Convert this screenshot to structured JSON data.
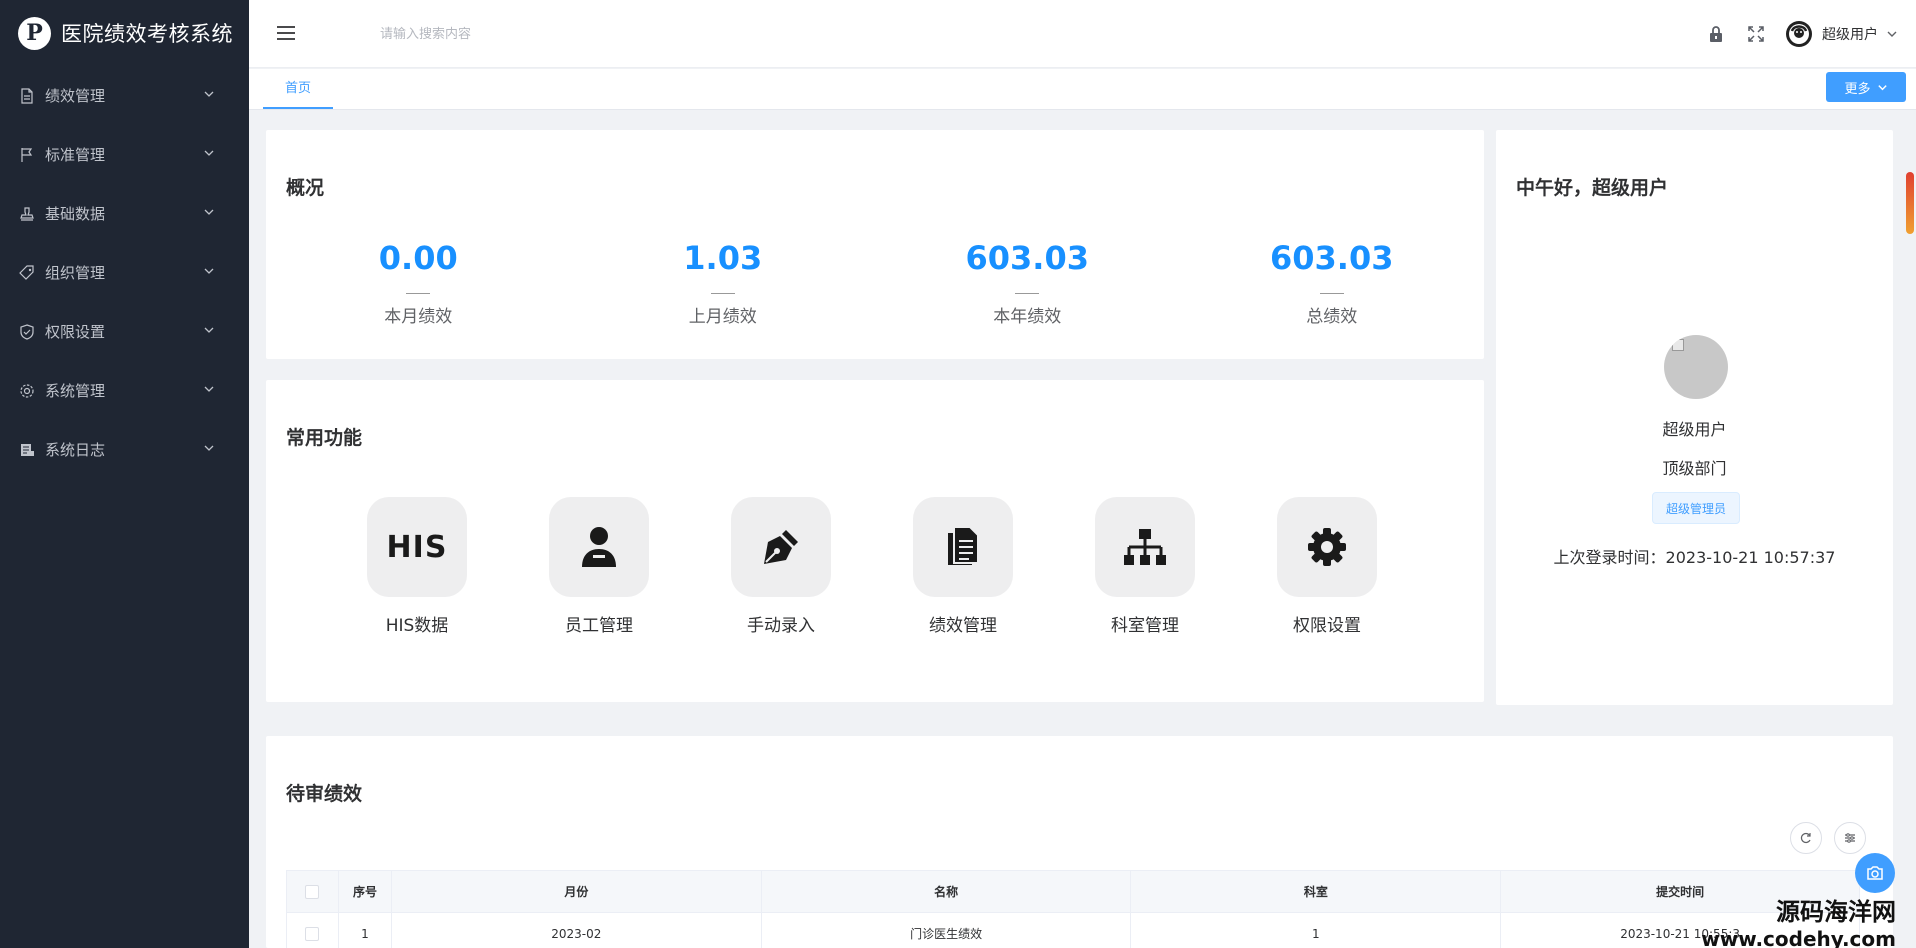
{
  "app": {
    "title": "医院绩效考核系统",
    "logo_text": "P"
  },
  "sidebar": {
    "items": [
      {
        "label": "绩效管理",
        "icon": "document-icon"
      },
      {
        "label": "标准管理",
        "icon": "flag-icon"
      },
      {
        "label": "基础数据",
        "icon": "stamp-icon"
      },
      {
        "label": "组织管理",
        "icon": "tag-icon"
      },
      {
        "label": "权限设置",
        "icon": "shield-icon"
      },
      {
        "label": "系统管理",
        "icon": "gear-icon"
      },
      {
        "label": "系统日志",
        "icon": "log-icon"
      }
    ]
  },
  "header": {
    "search_placeholder": "请输入搜索内容",
    "user_name": "超级用户"
  },
  "tabs": {
    "home": "首页",
    "more": "更多"
  },
  "overview": {
    "title": "概况",
    "stats": [
      {
        "value": "0.00",
        "label": "本月绩效"
      },
      {
        "value": "1.03",
        "label": "上月绩效"
      },
      {
        "value": "603.03",
        "label": "本年绩效"
      },
      {
        "value": "603.03",
        "label": "总绩效"
      }
    ]
  },
  "functions": {
    "title": "常用功能",
    "items": [
      {
        "label": "HIS数据",
        "icon": "his-text-icon",
        "icon_text": "HIS"
      },
      {
        "label": "员工管理",
        "icon": "employee-icon"
      },
      {
        "label": "手动录入",
        "icon": "pen-icon"
      },
      {
        "label": "绩效管理",
        "icon": "documents-icon"
      },
      {
        "label": "科室管理",
        "icon": "org-chart-icon"
      },
      {
        "label": "权限设置",
        "icon": "gear-icon"
      }
    ]
  },
  "profile": {
    "greeting": "中午好，超级用户",
    "name": "超级用户",
    "department": "顶级部门",
    "role": "超级管理员",
    "last_login": "上次登录时间：2023-10-21 10:57:37"
  },
  "pending": {
    "title": "待审绩效",
    "columns": [
      "序号",
      "月份",
      "名称",
      "科室",
      "提交时间"
    ],
    "rows": [
      {
        "index": "1",
        "month": "2023-02",
        "name": "门诊医生绩效",
        "dept": "1",
        "submitted": "2023-10-21 10:55:3"
      }
    ]
  },
  "watermark": {
    "line1": "源码海洋网",
    "line2": "www.codehy.com"
  },
  "colors": {
    "sidebar_bg": "#1f2633",
    "accent": "#409eff",
    "stat_blue": "#1890ff"
  }
}
